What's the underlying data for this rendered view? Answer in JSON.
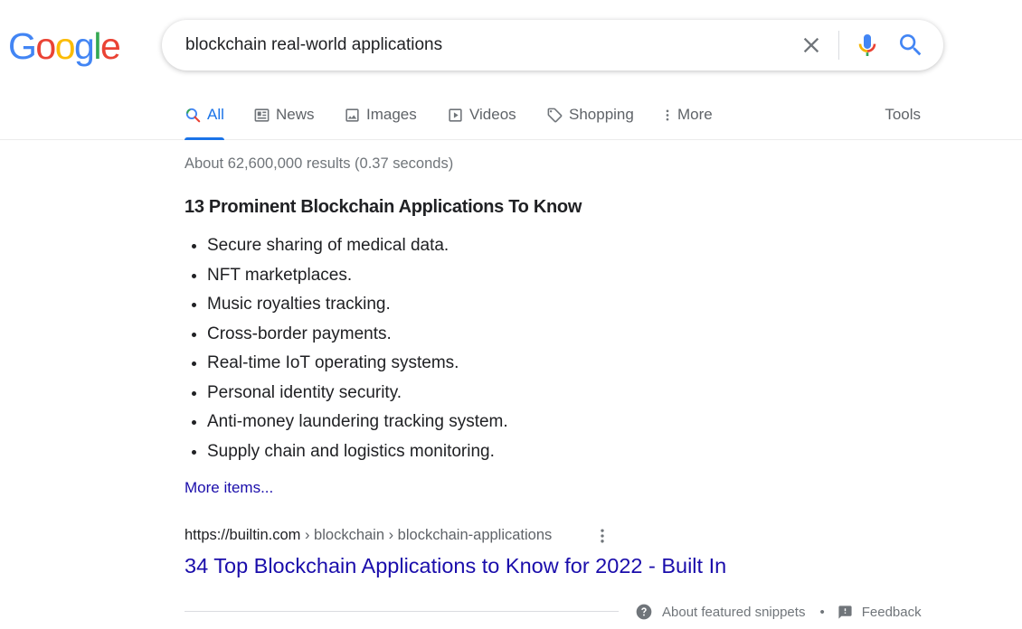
{
  "logo": {
    "letters": [
      "G",
      "o",
      "o",
      "g",
      "l",
      "e"
    ],
    "colors": [
      "#4285f4",
      "#ea4335",
      "#fbbc05",
      "#4285f4",
      "#34a853",
      "#ea4335"
    ]
  },
  "search": {
    "value": "blockchain real-world applications"
  },
  "tabs": [
    {
      "label": "All",
      "icon": "search-icon",
      "active": true
    },
    {
      "label": "News",
      "icon": "news-icon"
    },
    {
      "label": "Images",
      "icon": "image-icon"
    },
    {
      "label": "Videos",
      "icon": "video-icon"
    },
    {
      "label": "Shopping",
      "icon": "tag-icon"
    },
    {
      "label": "More",
      "icon": "more-vert-icon"
    }
  ],
  "tools_label": "Tools",
  "stats": "About 62,600,000 results (0.37 seconds)",
  "snippet": {
    "title": "13 Prominent Blockchain Applications To Know",
    "items": [
      "Secure sharing of medical data.",
      "NFT marketplaces.",
      "Music royalties tracking.",
      "Cross-border payments.",
      "Real-time IoT operating systems.",
      "Personal identity security.",
      "Anti-money laundering tracking system.",
      "Supply chain and logistics monitoring."
    ],
    "more_items": "More items..."
  },
  "result": {
    "domain": "https://builtin.com",
    "path": " › blockchain › blockchain-applications",
    "title": "34 Top Blockchain Applications to Know for 2022 - Built In"
  },
  "footer": {
    "about": "About featured snippets",
    "separator": "•",
    "feedback": "Feedback"
  },
  "colors": {
    "link": "#1a0dab",
    "accent": "#1a73e8",
    "muted": "#70757a"
  }
}
